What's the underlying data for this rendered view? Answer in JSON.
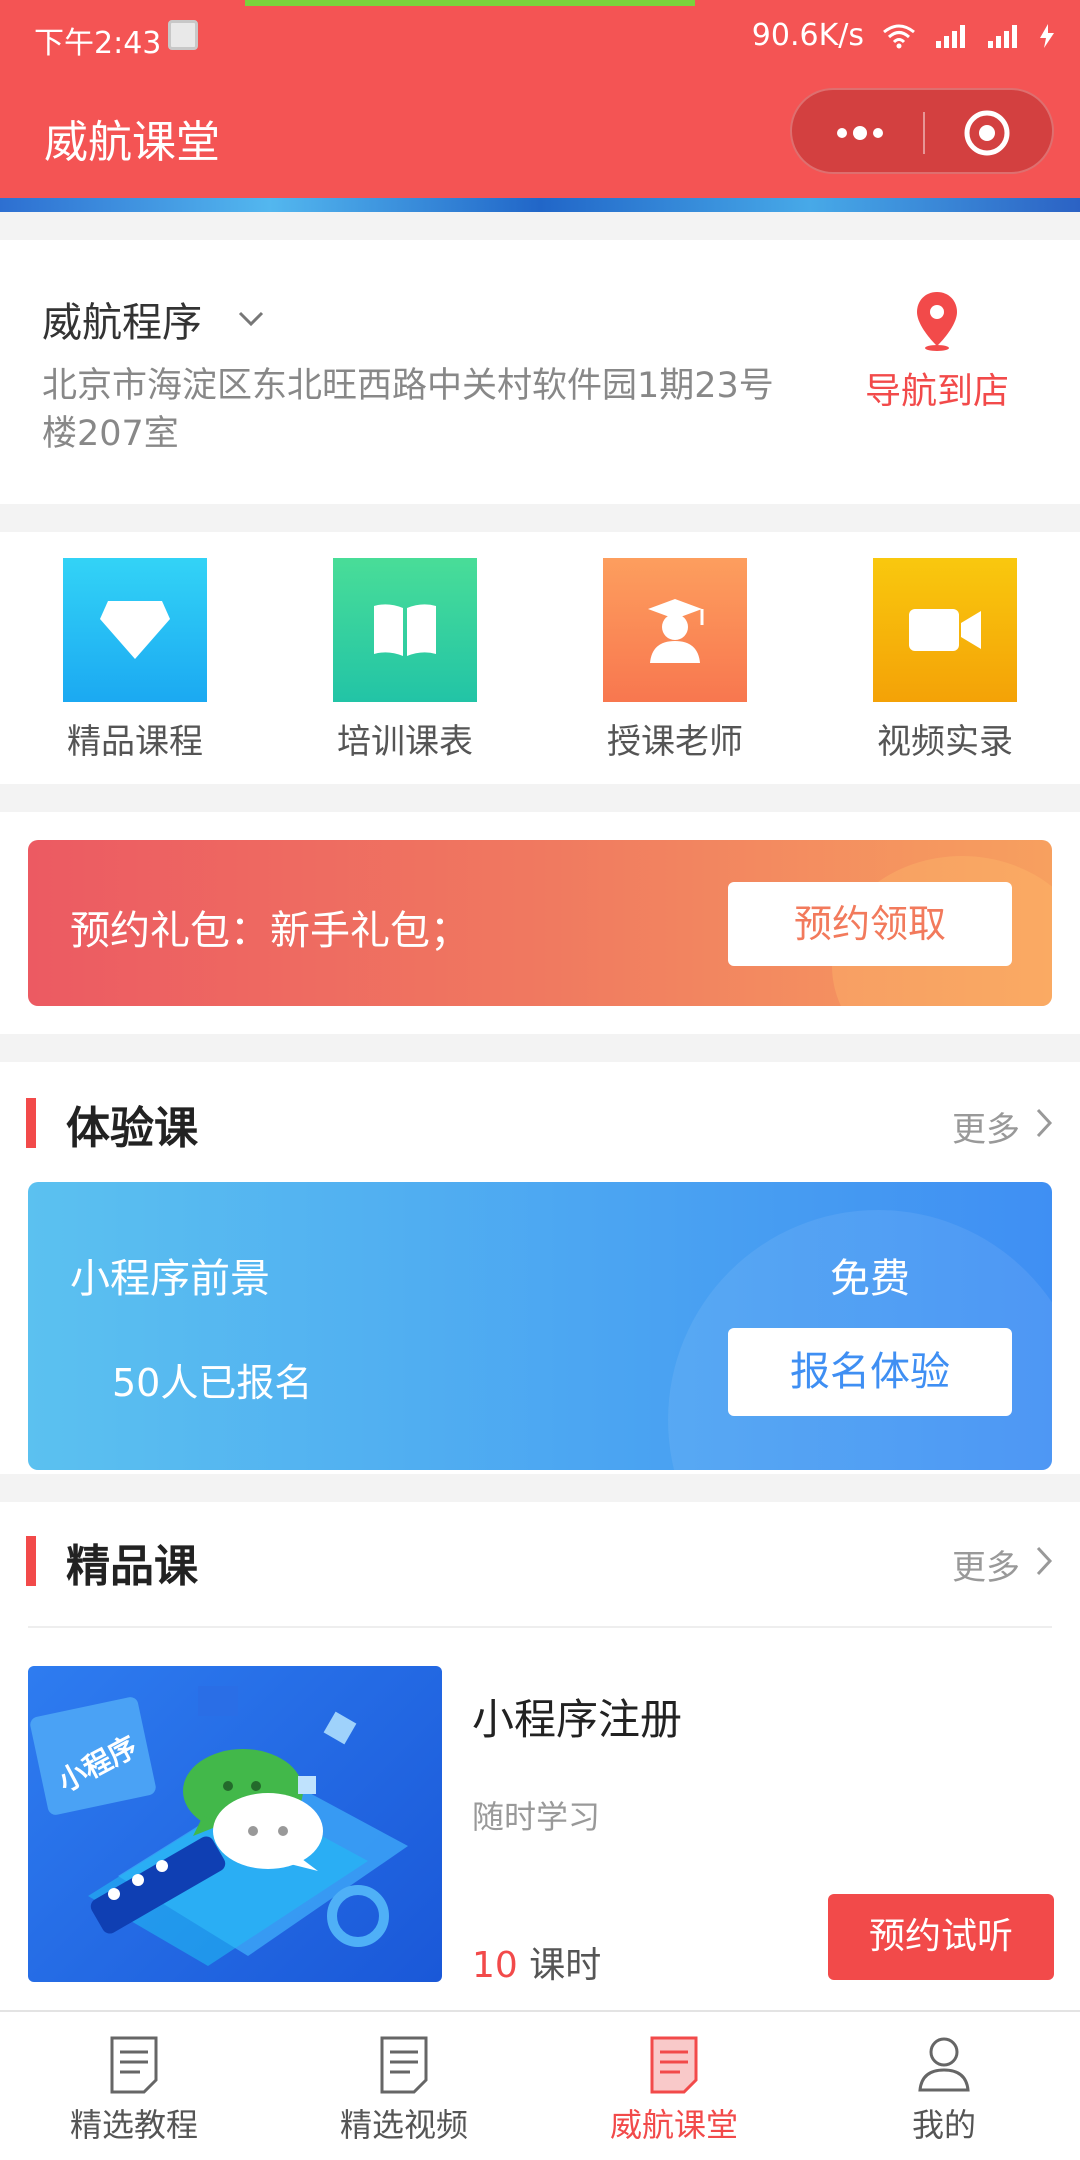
{
  "status_bar": {
    "time": "下午2:43",
    "network_speed": "90.6K/s"
  },
  "header": {
    "title": "威航课堂",
    "more_icon": "more-dots-icon",
    "close_icon": "target-circle-icon"
  },
  "store": {
    "name": "威航程序",
    "address": "北京市海淀区东北旺西路中关村软件园1期23号楼207室",
    "navigate_label": "导航到店"
  },
  "menu": {
    "items": [
      {
        "label": "精品课程",
        "icon": "diamond-icon",
        "color": "#27c2f4"
      },
      {
        "label": "培训课表",
        "icon": "book-icon",
        "color": "#2fd0a1"
      },
      {
        "label": "授课老师",
        "icon": "teacher-icon",
        "color": "#fb8a58"
      },
      {
        "label": "视频实录",
        "icon": "video-camera-icon",
        "color": "#f7b30a"
      }
    ]
  },
  "promo": {
    "text": "预约礼包：新手礼包；",
    "button": "预约领取"
  },
  "trial_section": {
    "title": "体验课",
    "more": "更多",
    "course_name": "小程序前景",
    "price": "免费",
    "enrolled": "50人已报名",
    "button": "报名体验"
  },
  "premium_section": {
    "title": "精品课",
    "more": "更多",
    "course": {
      "image_text": "小程序",
      "title": "小程序注册",
      "subtitle": "随时学习",
      "hours_num": "10",
      "hours_unit": " 课时",
      "button": "预约试听"
    }
  },
  "tabbar": {
    "tabs": [
      {
        "label": "精选教程",
        "active": false
      },
      {
        "label": "精选视频",
        "active": false
      },
      {
        "label": "威航课堂",
        "active": true
      },
      {
        "label": "我的",
        "active": false
      }
    ]
  },
  "colors": {
    "brand": "#f45454",
    "accent_red": "#f24a4a",
    "trial_blue": "#3f8ff3"
  }
}
